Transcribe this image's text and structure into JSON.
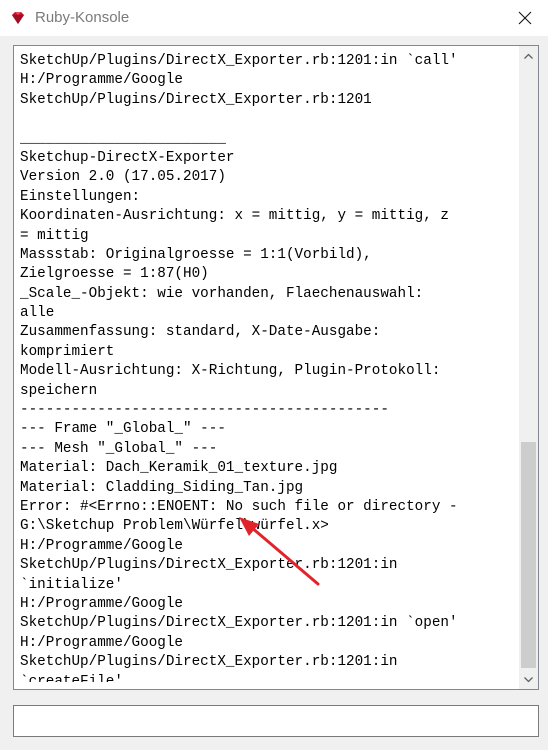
{
  "window": {
    "title": "Ruby-Konsole",
    "close_glyph": "✕"
  },
  "console": {
    "lines": [
      "SketchUp/Plugins/DirectX_Exporter.rb:1201:in `call'",
      "H:/Programme/Google",
      "SketchUp/Plugins/DirectX_Exporter.rb:1201",
      "",
      "________________________",
      "Sketchup-DirectX-Exporter",
      "Version 2.0 (17.05.2017)",
      "Einstellungen:",
      "Koordinaten-Ausrichtung: x = mittig, y = mittig, z",
      "= mittig",
      "Massstab: Originalgroesse = 1:1(Vorbild),",
      "Zielgroesse = 1:87(H0)",
      "_Scale_-Objekt: wie vorhanden, Flaechenauswahl:",
      "alle",
      "Zusammenfassung: standard, X-Date-Ausgabe:",
      "komprimiert",
      "Modell-Ausrichtung: X-Richtung, Plugin-Protokoll:",
      "speichern",
      "-------------------------------------------",
      "--- Frame \"_Global_\" ---",
      "--- Mesh \"_Global_\" ---",
      "Material: Dach_Keramik_01_texture.jpg",
      "Material: Cladding_Siding_Tan.jpg",
      "Error: #<Errno::ENOENT: No such file or directory -",
      "G:\\Sketchup Problem\\Würfel\\würfel.x>",
      "H:/Programme/Google",
      "SketchUp/Plugins/DirectX_Exporter.rb:1201:in",
      "`initialize'",
      "H:/Programme/Google",
      "SketchUp/Plugins/DirectX_Exporter.rb:1201:in `open'",
      "H:/Programme/Google",
      "SketchUp/Plugins/DirectX_Exporter.rb:1201:in",
      "`createFile'"
    ]
  },
  "input": {
    "value": "",
    "placeholder": ""
  },
  "colors": {
    "annotation_arrow": "#e0242a",
    "ruby_icon": "#c8102e"
  },
  "icons": {
    "app": "ruby-icon",
    "close": "close-icon",
    "scroll_up": "chevron-up-icon",
    "scroll_down": "chevron-down-icon",
    "annotation": "red-arrow-annotation"
  }
}
